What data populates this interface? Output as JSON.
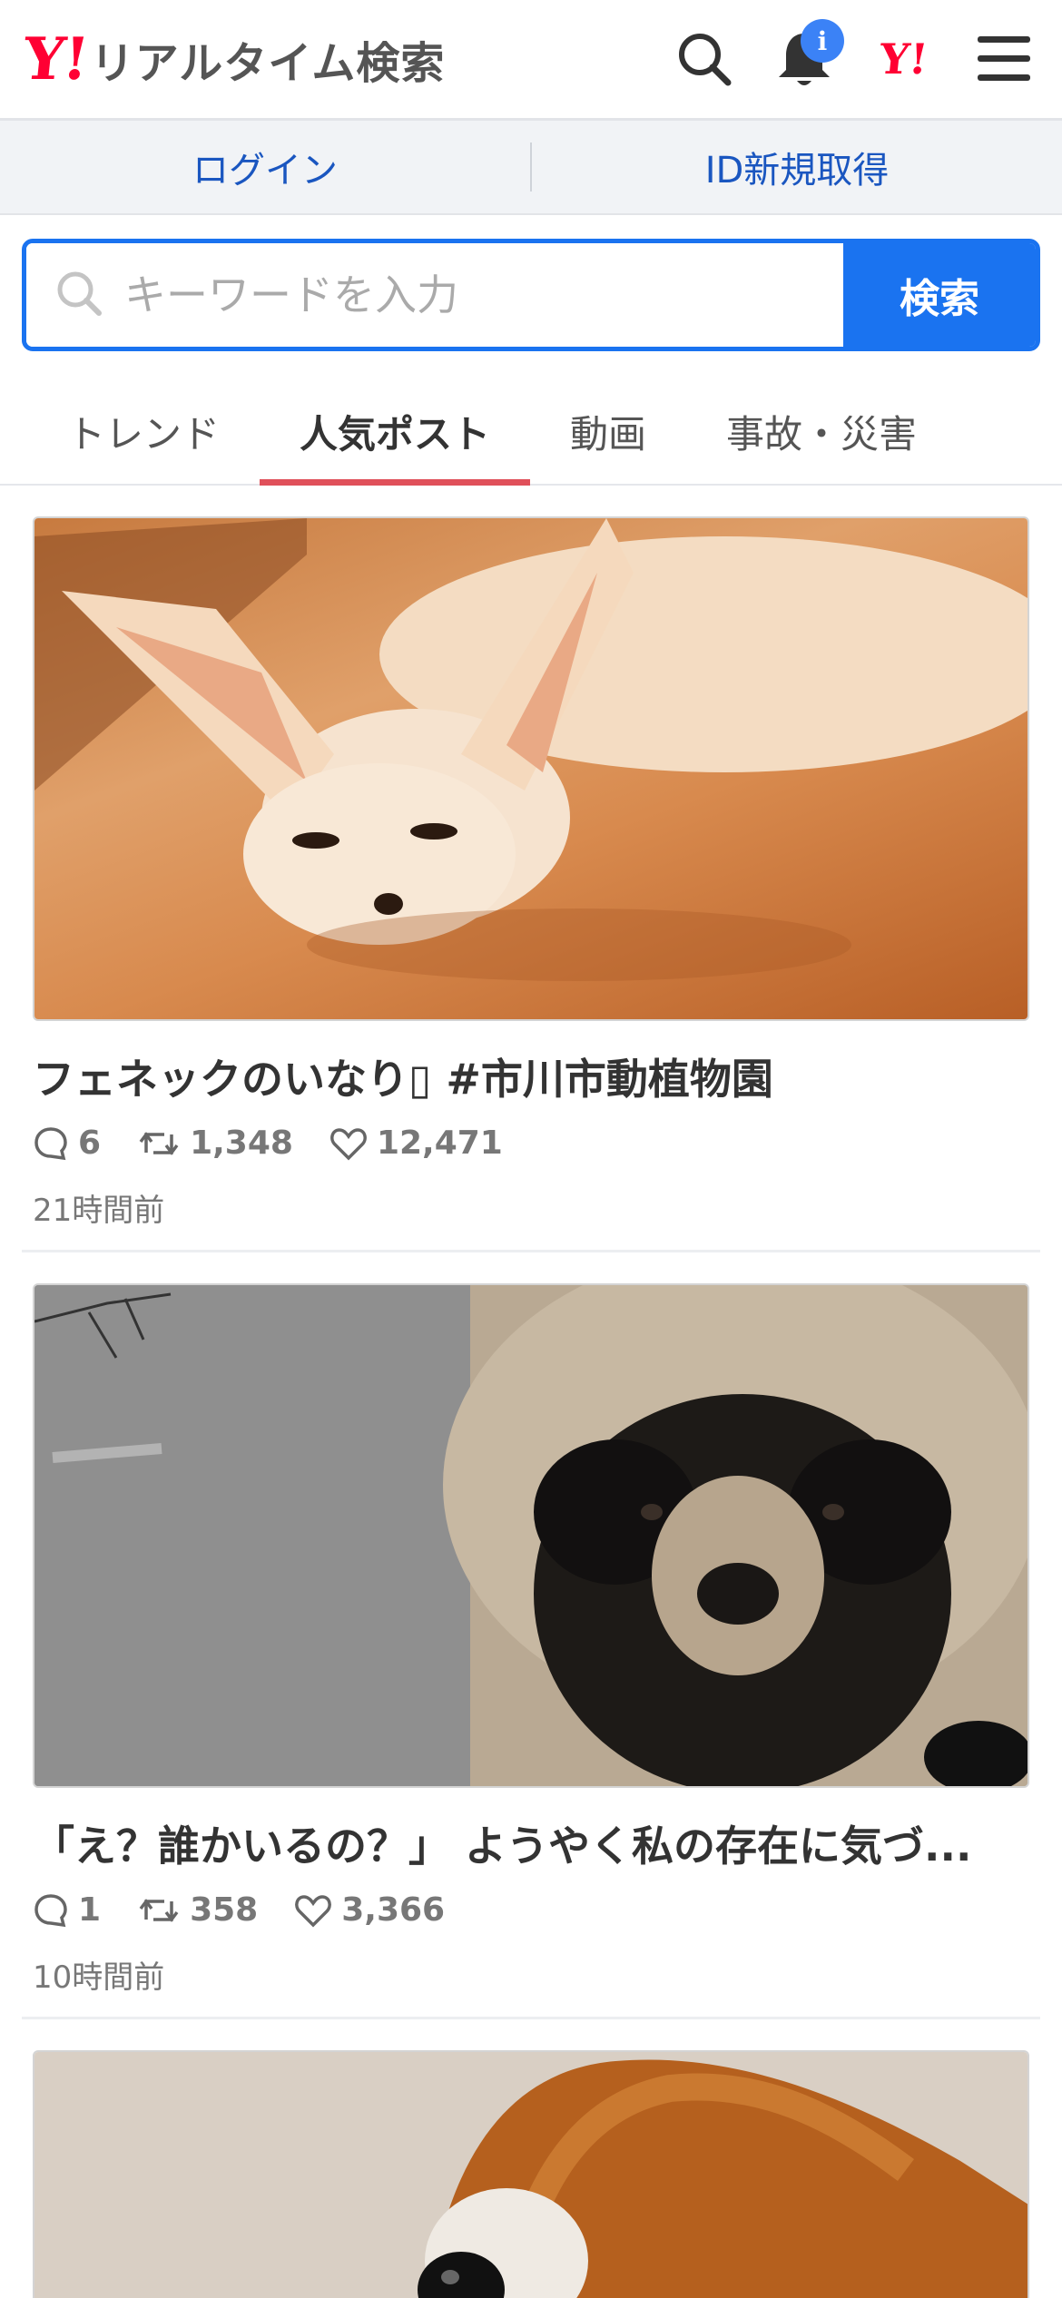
{
  "header": {
    "logo_y": "Y!",
    "logo_text": "リアルタイム検索",
    "notification_badge": "i",
    "mini_logo": "Y!",
    "icons": [
      "search-icon",
      "bell-icon",
      "menu-icon"
    ]
  },
  "loginbar": {
    "login": "ログイン",
    "register": "ID新規取得"
  },
  "search": {
    "placeholder": "キーワードを入力",
    "button": "検索"
  },
  "tabs": [
    {
      "label": "トレンド",
      "active": false
    },
    {
      "label": "人気ポスト",
      "active": true
    },
    {
      "label": "動画",
      "active": false
    },
    {
      "label": "事故・災害",
      "active": false
    }
  ],
  "posts": [
    {
      "title": "フェネックのいなり▯ #市川市動植物園",
      "replies": "6",
      "reposts": "1,348",
      "likes": "12,471",
      "time": "21時間前"
    },
    {
      "title": "「え？誰かいるの？」 ようやく私の存在に気づ...",
      "replies": "1",
      "reposts": "358",
      "likes": "3,366",
      "time": "10時間前"
    }
  ],
  "colors": {
    "brand_red": "#ff0033",
    "accent_blue": "#1a73f0",
    "tab_underline": "#e0505a",
    "link_blue": "#1a56c0"
  }
}
